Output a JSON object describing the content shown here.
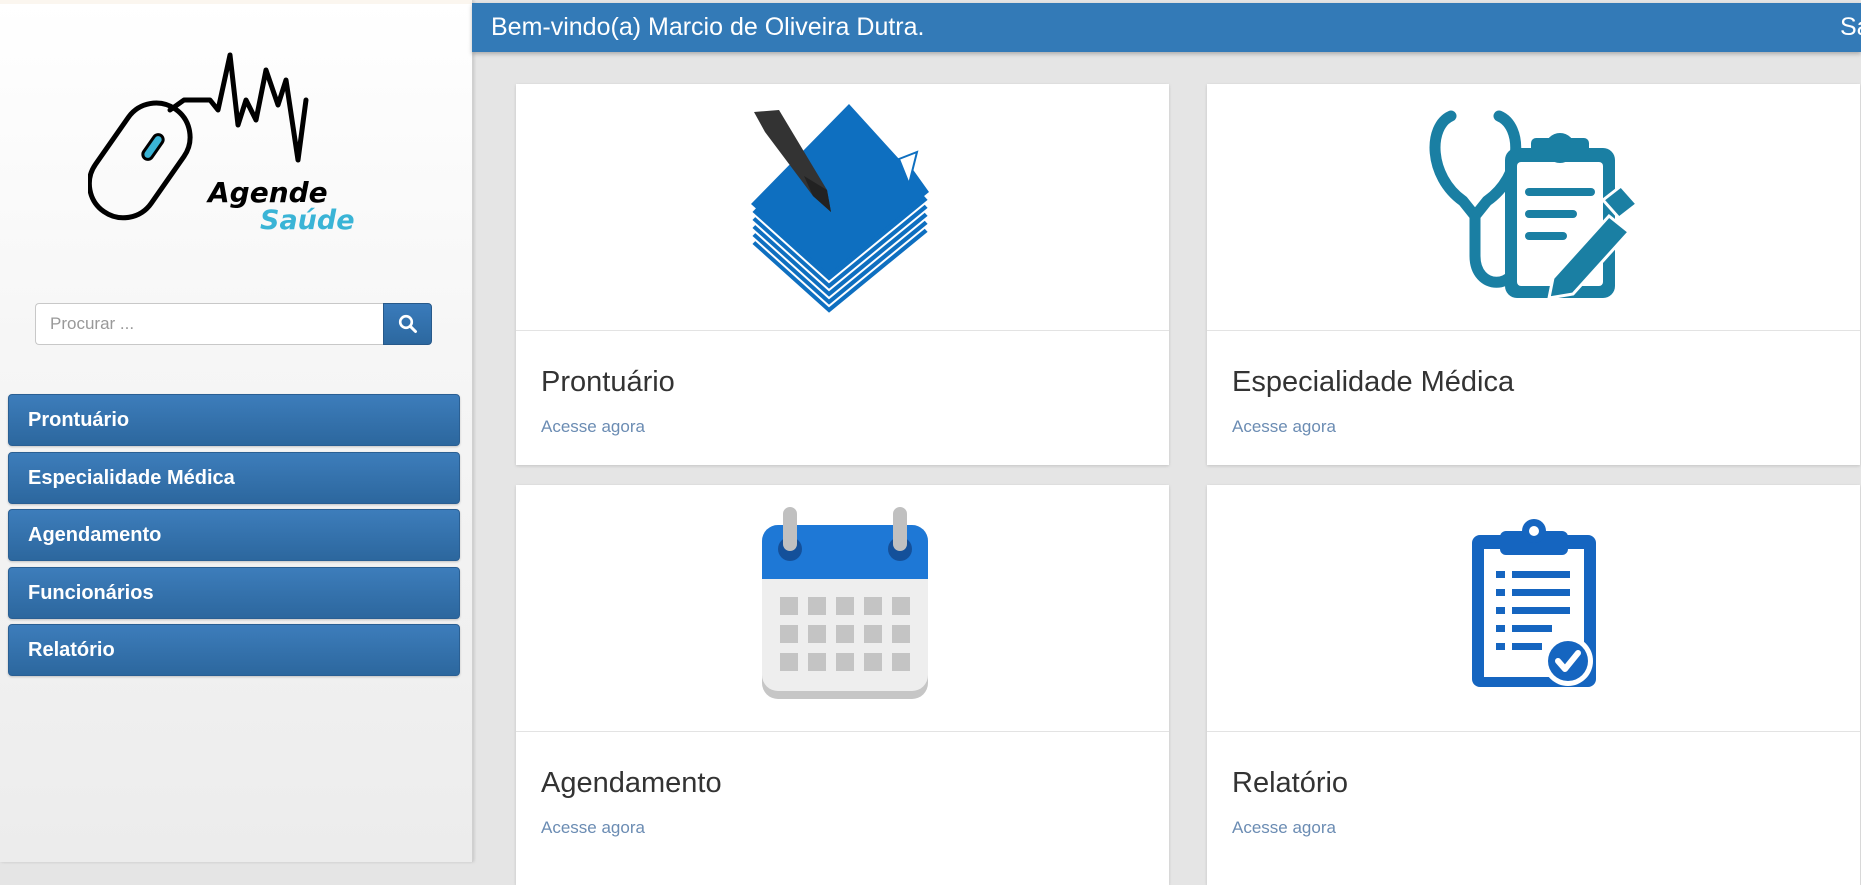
{
  "app": {
    "name_line1": "Agende",
    "name_line2": "Saúde"
  },
  "search": {
    "placeholder": "Procurar ...",
    "icon": "search-icon"
  },
  "sidebar": {
    "items": [
      {
        "label": "Prontuário"
      },
      {
        "label": "Especialidade Médica"
      },
      {
        "label": "Agendamento"
      },
      {
        "label": "Funcionários"
      },
      {
        "label": "Relatório"
      }
    ]
  },
  "header": {
    "welcome": "Bem-vindo(a) Marcio de Oliveira Dutra.",
    "right_text": "Sa"
  },
  "cards": [
    {
      "title": "Prontuário",
      "link": "Acesse agora",
      "icon": "documents-pen-icon"
    },
    {
      "title": "Especialidade Médica",
      "link": "Acesse agora",
      "icon": "stethoscope-clipboard-icon"
    },
    {
      "title": "Agendamento",
      "link": "Acesse agora",
      "icon": "calendar-icon"
    },
    {
      "title": "Relatório",
      "link": "Acesse agora",
      "icon": "clipboard-check-icon"
    }
  ],
  "colors": {
    "primary": "#337ab7",
    "teal": "#1a7fa3",
    "accent_blue": "#1e73be",
    "logo_teal": "#3ab4d6"
  }
}
